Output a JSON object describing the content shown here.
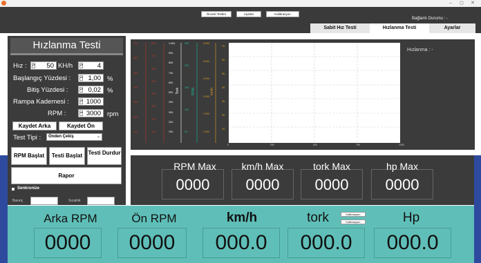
{
  "topbar": {
    "buttons": [
      "Önceki Testler",
      "Ayarlar",
      "Kalibrasyon"
    ],
    "connection": "Bağlantı Durumu :  -"
  },
  "tabs": [
    "Sabit Hız Testi",
    "Hızlanma Testi",
    "Ayarlar"
  ],
  "left": {
    "title": "Hızlanma Testi",
    "speed_label": "Hız :",
    "speed_value": "50",
    "speed_unit": "KH/h",
    "speed_step": "4",
    "start_label": "Başlangıç Yüzdesi :",
    "start_value": "1,00",
    "start_unit": "%",
    "end_label": "Bitiş Yüzdesi :",
    "end_value": "0,02",
    "end_unit": "%",
    "ramp_label": "Rampa Kademesi :",
    "ramp_value": "1000",
    "rpm_label": "RPM :",
    "rpm_value": "3000",
    "rpm_unit": "rpm",
    "save_rear": "Kaydet Arka",
    "save_front": "Kaydet Ön",
    "test_type_label": "Test Tipi :",
    "test_type_value": "Önden Çekiş",
    "rpm_start": "RPM Başlat",
    "test_start": "Testi Başlat",
    "test_stop": "Testi Durdur",
    "report": "Rapor",
    "sync": "Senkronize",
    "pressure": "Basınç",
    "temperature": "Sıcaklık"
  },
  "chart": {
    "legend": "Hızlanma :  -",
    "axes": [
      {
        "color": "#c0392b",
        "ticks": [
          "700-",
          "600-",
          "500-",
          "400-",
          "300-",
          "200-",
          "100-"
        ]
      },
      {
        "color": "#c0392b",
        "ticks": [
          "800-",
          "700-",
          "600-",
          "500-",
          "400-",
          "300-",
          "200-",
          "100-"
        ]
      },
      {
        "color": "#ffffff",
        "label": "Tork",
        "ticks": [
          "1.000-",
          "900-",
          "800-",
          "700-",
          "600-",
          "500-",
          "400-",
          "300-",
          "200-",
          "100-"
        ]
      },
      {
        "color": "#1abc9c",
        "label": "RPM",
        "ticks": [
          "250-",
          "200-",
          "150-",
          "100-",
          "50-"
        ]
      },
      {
        "color": "#e6a020",
        "label": "km/h",
        "ticks": [
          "6.000-",
          "5.000-",
          "4.000-",
          "3.000-",
          "2.000-",
          "1.000-"
        ]
      }
    ],
    "y_ticks": [
      "7K-",
      "6K-",
      "5K-",
      "4K-",
      "3K-",
      "2K-",
      "1K-"
    ],
    "x_ticks": [
      "0",
      "250",
      "500",
      "750",
      "1000"
    ]
  },
  "max": {
    "rpm_label": "RPM Max",
    "rpm_value": "0000",
    "kmh_label": "km/h Max",
    "kmh_value": "0000",
    "tork_label": "tork Max",
    "tork_value": "0000",
    "hp_label": "hp Max",
    "hp_value": "0000"
  },
  "gauges": {
    "rear_rpm_label": "Arka RPM",
    "rear_rpm_value": "0000",
    "front_rpm_label": "Ön RPM",
    "front_rpm_value": "0000",
    "kmh_label": "km/h",
    "kmh_value": "000.0",
    "tork_label": "tork",
    "tork_value": "000.0",
    "hp_label": "Hp",
    "hp_value": "000.0",
    "calib1": "Kalibrasyon",
    "calib2": "Kalibrasyon"
  }
}
